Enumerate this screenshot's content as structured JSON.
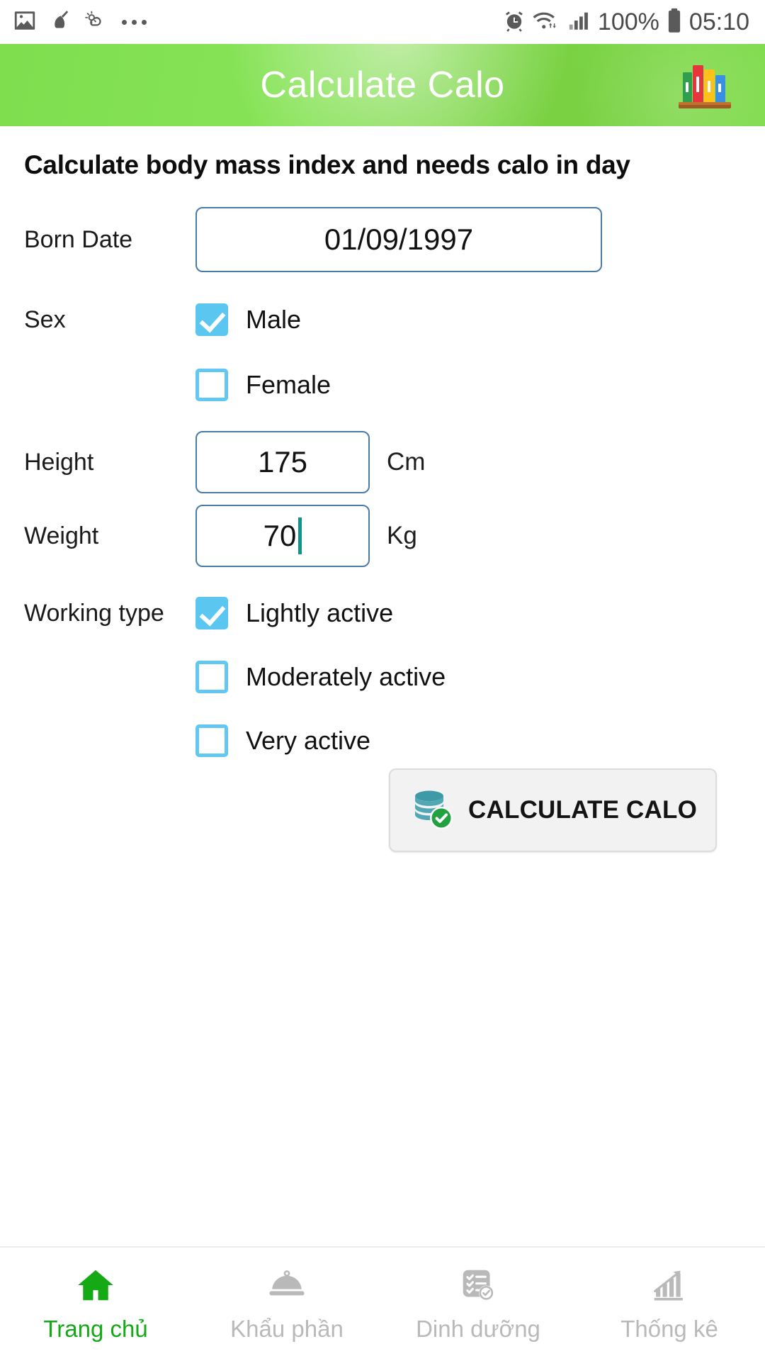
{
  "status_bar": {
    "left_icons": [
      "image-icon",
      "broom-icon",
      "weather-icon",
      "more-dots-icon"
    ],
    "alarm_icon": "alarm-clock-icon",
    "wifi_icon": "wifi-icon",
    "signal_icon": "cellular-signal-icon",
    "battery_percent": "100%",
    "battery_icon": "battery-full-icon",
    "time": "05:10"
  },
  "app_bar": {
    "title": "Calculate Calo",
    "action_icon": "books-shelf-icon",
    "background_color": "#7fdd4f"
  },
  "page": {
    "heading": "Calculate body mass index and needs calo in day"
  },
  "form": {
    "born_date": {
      "label": "Born Date",
      "value": "01/09/1997"
    },
    "sex": {
      "label": "Sex",
      "options": [
        {
          "label": "Male",
          "checked": true
        },
        {
          "label": "Female",
          "checked": false
        }
      ]
    },
    "height": {
      "label": "Height",
      "value": "175",
      "unit": "Cm"
    },
    "weight": {
      "label": "Weight",
      "value": "70",
      "unit": "Kg",
      "focused": true
    },
    "working_type": {
      "label": "Working type",
      "options": [
        {
          "label": "Lightly active",
          "checked": true
        },
        {
          "label": "Moderately active",
          "checked": false
        },
        {
          "label": "Very active",
          "checked": false
        }
      ]
    },
    "submit": {
      "label": "CALCULATE CALO",
      "icon": "database-check-icon"
    },
    "checkbox_color": "#5bc6f0",
    "input_border_color": "#4a7ba8",
    "caret_color": "#0f9488"
  },
  "bottom_nav": {
    "active_color": "#16a916",
    "inactive_color": "#b9b9b9",
    "items": [
      {
        "label": "Trang chủ",
        "icon": "home-icon",
        "active": true
      },
      {
        "label": "Khẩu phần",
        "icon": "food-dome-icon",
        "active": false
      },
      {
        "label": "Dinh dưỡng",
        "icon": "checklist-check-icon",
        "active": false
      },
      {
        "label": "Thống kê",
        "icon": "bar-chart-arrow-icon",
        "active": false
      }
    ]
  }
}
